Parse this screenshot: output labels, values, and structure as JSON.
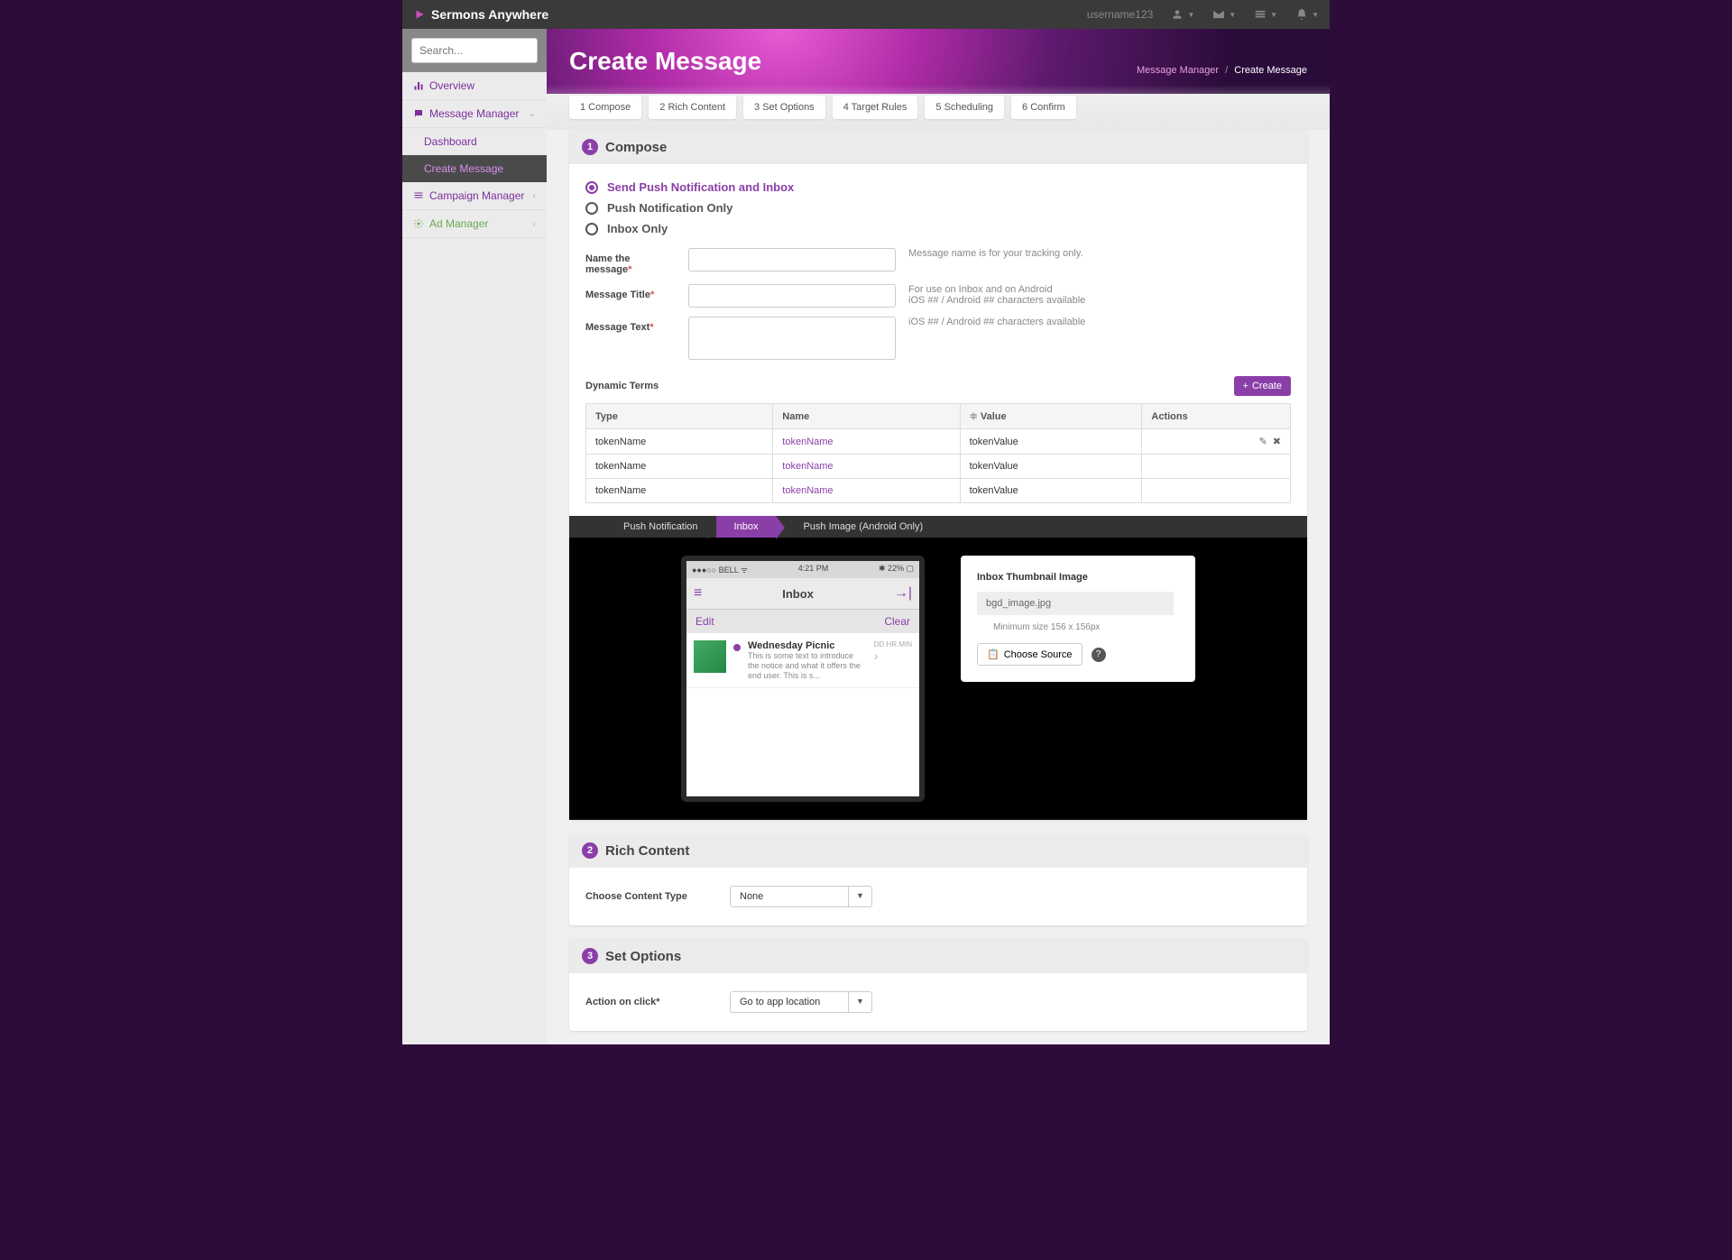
{
  "brand": "Sermons Anywhere",
  "username": "username123",
  "search_placeholder": "Search...",
  "nav": {
    "overview": "Overview",
    "message_manager": "Message Manager",
    "dashboard": "Dashboard",
    "create_message": "Create Message",
    "campaign_manager": "Campaign Manager",
    "ad_manager": "Ad Manager"
  },
  "page_title": "Create Message",
  "breadcrumb": {
    "parent": "Message Manager",
    "current": "Create Message"
  },
  "steps": [
    "1 Compose",
    "2 Rich Content",
    "3 Set Options",
    "4 Target Rules",
    "5 Scheduling",
    "6 Confirm"
  ],
  "compose": {
    "header": "Compose",
    "num": "1",
    "radios": [
      "Send Push Notification and Inbox",
      "Push Notification Only",
      "Inbox Only"
    ],
    "name_label": "Name the message",
    "name_hint": "Message name is for your tracking only.",
    "title_label": "Message Title",
    "title_hint1": "For use on Inbox and on Android",
    "title_hint2": "iOS ## / Android ## characters available",
    "text_label": "Message Text",
    "text_hint": "iOS ## / Android ## characters available",
    "dynamic_terms": "Dynamic Terms",
    "create_btn": "Create",
    "table": {
      "headers": [
        "Type",
        "Name",
        "Value",
        "Actions"
      ],
      "rows": [
        {
          "type": "tokenName",
          "name": "tokenName",
          "value": "tokenValue"
        },
        {
          "type": "tokenName",
          "name": "tokenName",
          "value": "tokenValue"
        },
        {
          "type": "tokenName",
          "name": "tokenName",
          "value": "tokenValue"
        }
      ]
    }
  },
  "preview": {
    "tabs": [
      "Push Notification",
      "Inbox",
      "Push Image (Android Only)"
    ],
    "status_left": "●●●○○ BELL ᯤ",
    "status_time": "4:21 PM",
    "status_right": "✱ 22% ▢",
    "inbox_title": "Inbox",
    "edit": "Edit",
    "clear": "Clear",
    "msg_title": "Wednesday Picnic",
    "msg_date": "DD.HR.MIN",
    "msg_desc": "This is some text to introduce the notice and what it offers the end user. This is s...",
    "thumb_title": "Inbox Thumbnail Image",
    "thumb_file": "bgd_image.jpg",
    "thumb_min": "Minimum size 156 x 156px",
    "choose_source": "Choose Source"
  },
  "rich": {
    "header": "Rich Content",
    "num": "2",
    "label": "Choose Content Type",
    "value": "None"
  },
  "options": {
    "header": "Set Options",
    "num": "3",
    "label": "Action on click",
    "value": "Go to app location"
  }
}
